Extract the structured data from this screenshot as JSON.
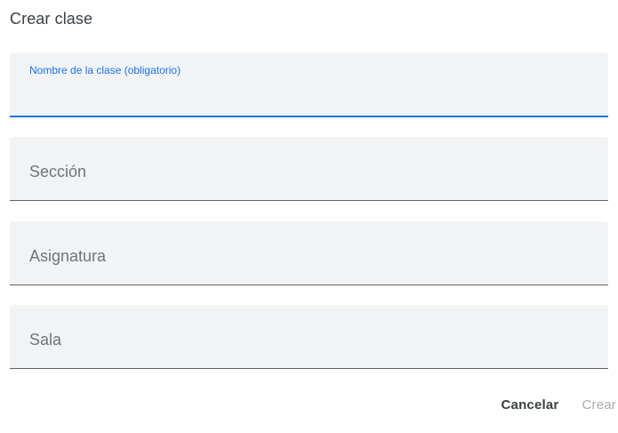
{
  "dialog": {
    "title": "Crear clase"
  },
  "fields": [
    {
      "label": "Nombre de la clase (obligatorio)",
      "value": "",
      "focused": true
    },
    {
      "label": "Sección",
      "value": ""
    },
    {
      "label": "Asignatura",
      "value": ""
    },
    {
      "label": "Sala",
      "value": ""
    }
  ],
  "actions": {
    "cancel_label": "Cancelar",
    "create_label": "Crear",
    "create_enabled": false
  },
  "colors": {
    "accent": "#1a73e8",
    "field_bg": "#f1f3f4",
    "disabled_text": "#a9acb0"
  }
}
